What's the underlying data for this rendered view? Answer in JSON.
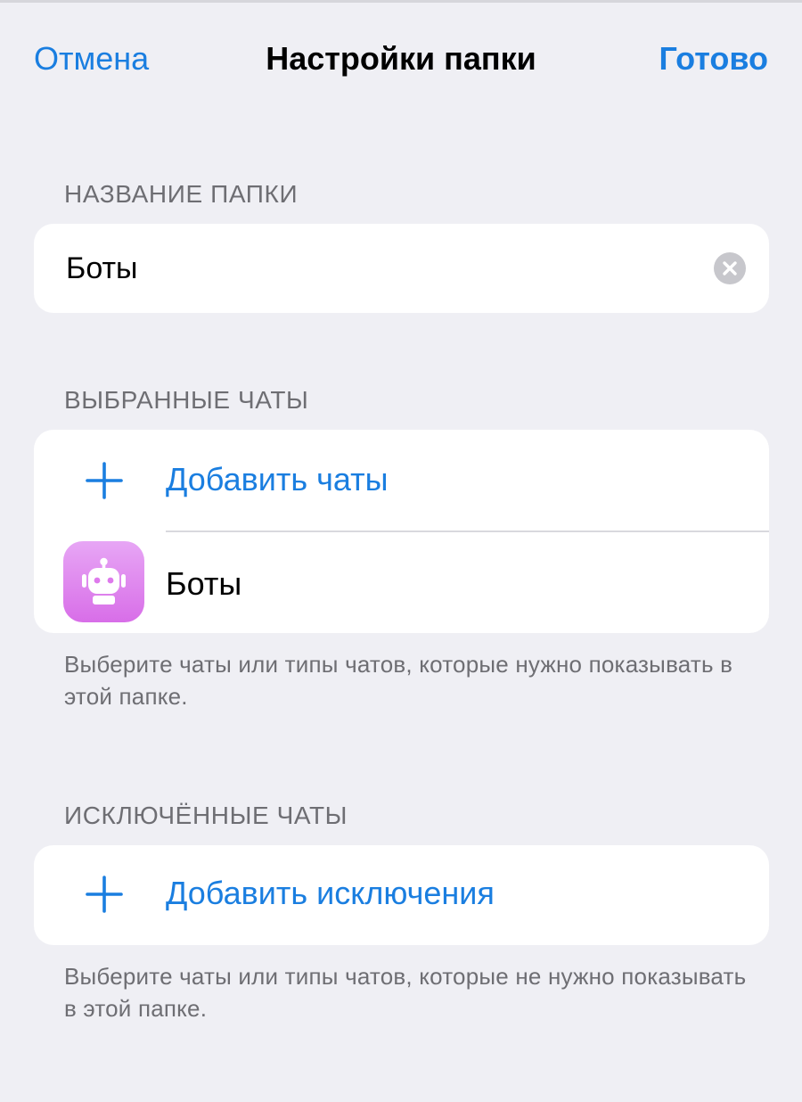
{
  "nav": {
    "cancel_label": "Отмена",
    "title": "Настройки папки",
    "done_label": "Готово"
  },
  "folder_name": {
    "header": "НАЗВАНИЕ ПАПКИ",
    "value": "Боты"
  },
  "included_chats": {
    "header": "ВЫБРАННЫЕ ЧАТЫ",
    "add_label": "Добавить чаты",
    "items": [
      {
        "label": "Боты",
        "icon": "robot-icon"
      }
    ],
    "footer": "Выберите чаты или типы чатов, которые нужно показывать в этой папке."
  },
  "excluded_chats": {
    "header": "ИСКЛЮЧЁННЫЕ ЧАТЫ",
    "add_label": "Добавить исключения",
    "footer": "Выберите чаты или типы чатов, которые не нужно показывать в этой папке."
  },
  "colors": {
    "accent": "#1a7ee0",
    "background": "#efeff4",
    "bot_avatar_top": "#e7a6f5",
    "bot_avatar_bottom": "#d86ee8"
  }
}
